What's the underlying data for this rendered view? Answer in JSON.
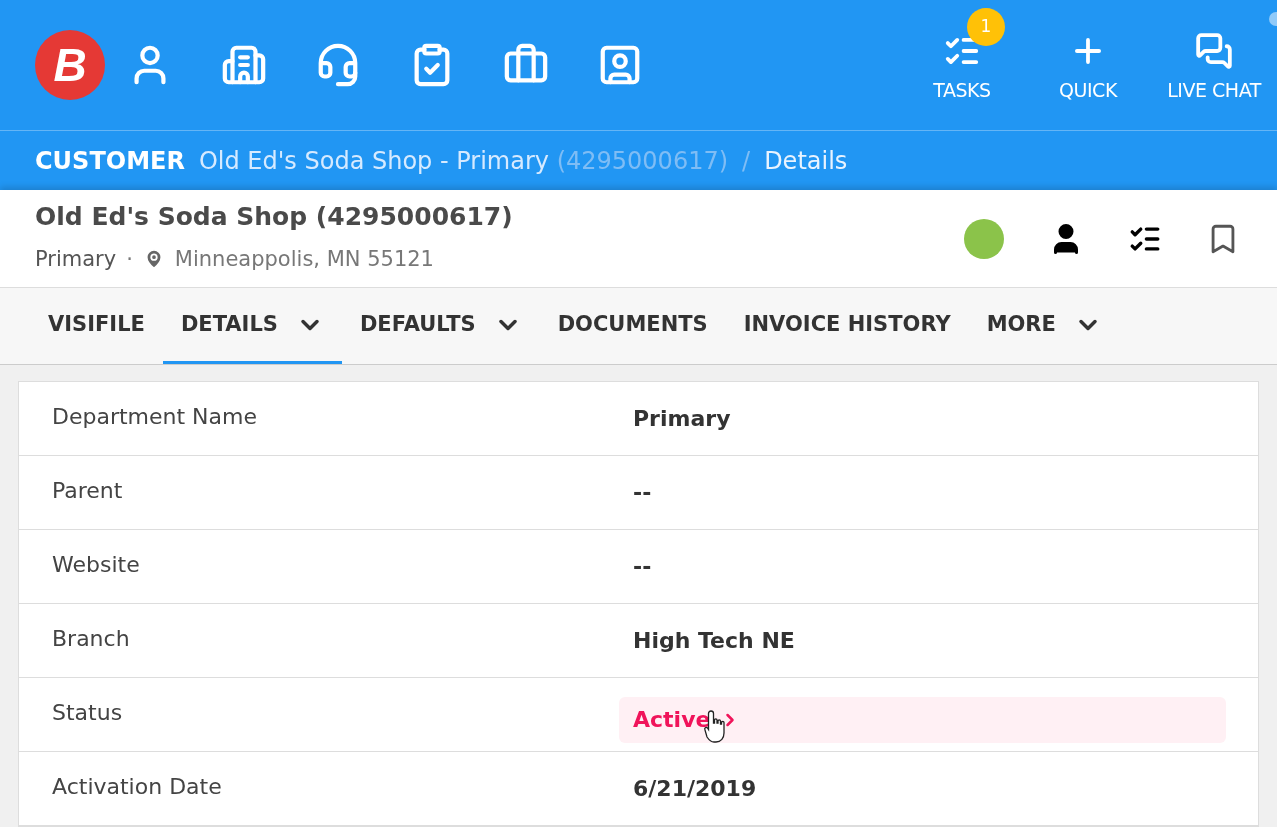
{
  "logo": {
    "letter": "B"
  },
  "nav_icons": [
    {
      "kind": "customer"
    },
    {
      "kind": "building"
    },
    {
      "kind": "agent"
    },
    {
      "kind": "clipboard"
    },
    {
      "kind": "briefcase"
    },
    {
      "kind": "contact"
    }
  ],
  "actions": [
    {
      "kind": "tasks",
      "label": "TASKS",
      "badge": "1"
    },
    {
      "kind": "quick",
      "label": "QUICK"
    },
    {
      "kind": "chat",
      "label": "LIVE CHAT"
    }
  ],
  "breadcrumb": {
    "section": "CUSTOMER",
    "record": "Old Ed's Soda Shop - Primary",
    "record_id": "(4295000617)",
    "separator": "/",
    "page": "Details"
  },
  "header": {
    "title": "Old Ed's Soda Shop (4295000617)",
    "department": "Primary",
    "dot": "·",
    "location": "Minneappolis, MN 55121",
    "status_dot": {
      "color": "#8bc34a"
    }
  },
  "tabs": [
    {
      "label": "VISIFILE",
      "selected": false,
      "dropdown": false
    },
    {
      "label": "DETAILS",
      "selected": true,
      "dropdown": true
    },
    {
      "label": "DEFAULTS",
      "selected": false,
      "dropdown": true
    },
    {
      "label": "DOCUMENTS",
      "selected": false,
      "dropdown": false
    },
    {
      "label": "INVOICE HISTORY",
      "selected": false,
      "dropdown": false
    },
    {
      "label": "MORE",
      "selected": false,
      "dropdown": true
    }
  ],
  "rows": [
    {
      "label": "Department Name",
      "value": "Primary",
      "kind": "text"
    },
    {
      "label": "Parent",
      "value": "--",
      "kind": "text"
    },
    {
      "label": "Website",
      "value": "--",
      "kind": "text"
    },
    {
      "label": "Branch",
      "value": "High Tech NE",
      "kind": "text"
    },
    {
      "label": "Status",
      "value": "Active",
      "kind": "link"
    },
    {
      "label": "Activation Date",
      "value": "6/21/2019",
      "kind": "text"
    }
  ]
}
